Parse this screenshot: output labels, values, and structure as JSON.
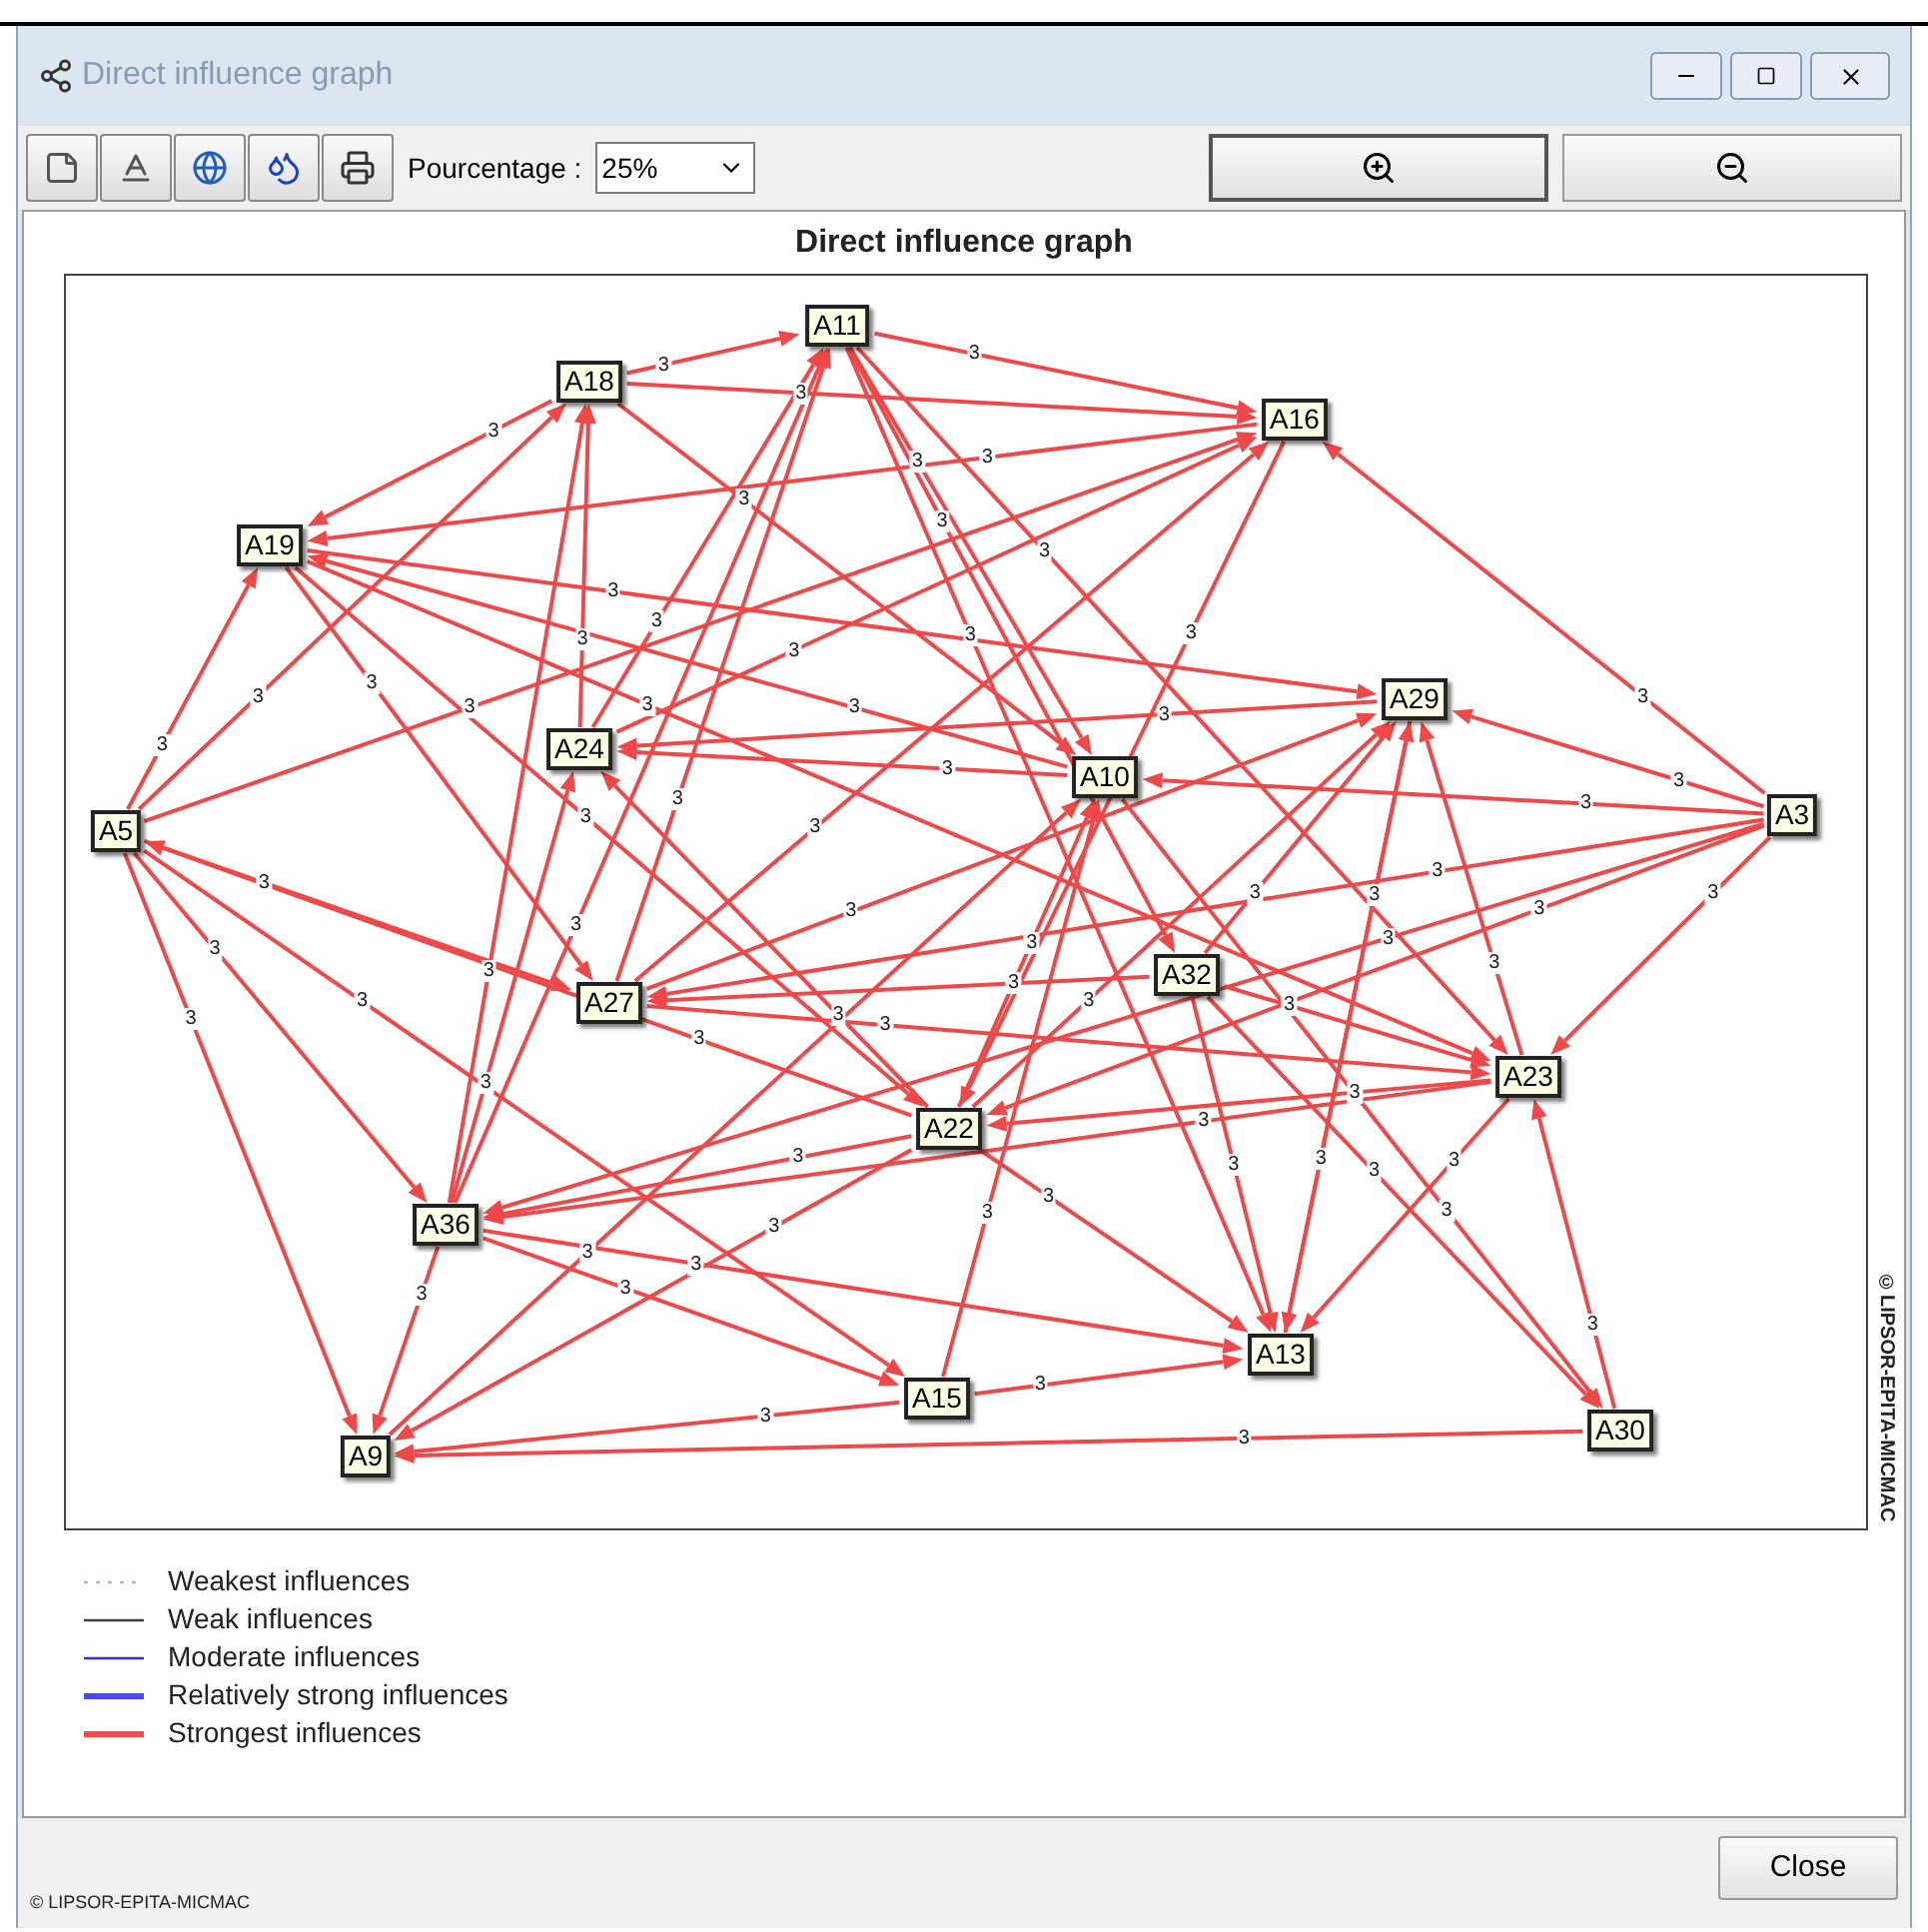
{
  "window": {
    "title": "Direct influence graph"
  },
  "toolbar": {
    "percent_label": "Pourcentage :",
    "percent_value": "25%"
  },
  "graph": {
    "title": "Direct influence graph",
    "nodes": [
      {
        "label": "A11"
      },
      {
        "label": "A18"
      },
      {
        "label": "A16"
      },
      {
        "label": "A19"
      },
      {
        "label": "A29"
      },
      {
        "label": "A24"
      },
      {
        "label": "A10"
      },
      {
        "label": "A5"
      },
      {
        "label": "A3"
      },
      {
        "label": "A32"
      },
      {
        "label": "A27"
      },
      {
        "label": "A23"
      },
      {
        "label": "A22"
      },
      {
        "label": "A36"
      },
      {
        "label": "A13"
      },
      {
        "label": "A15"
      },
      {
        "label": "A30"
      },
      {
        "label": "A9"
      }
    ],
    "edges": [
      {
        "label": "3"
      },
      {
        "label": "3"
      },
      {
        "label": "3"
      },
      {
        "label": "3"
      },
      {
        "label": "3"
      },
      {
        "label": "3"
      },
      {
        "label": "3"
      },
      {
        "label": "3"
      },
      {
        "label": "3"
      },
      {
        "label": "3"
      },
      {
        "label": "3"
      },
      {
        "label": "3"
      },
      {
        "label": "3"
      },
      {
        "label": "3"
      },
      {
        "label": "3"
      },
      {
        "label": "3"
      },
      {
        "label": "3"
      },
      {
        "label": "3"
      },
      {
        "label": "3"
      },
      {
        "label": "3"
      },
      {
        "label": "3"
      },
      {
        "label": "3"
      },
      {
        "label": "3"
      },
      {
        "label": "3"
      },
      {
        "label": "3"
      },
      {
        "label": "3"
      },
      {
        "label": "3"
      },
      {
        "label": "3"
      },
      {
        "label": "3"
      },
      {
        "label": "3"
      },
      {
        "label": "3"
      },
      {
        "label": "3"
      },
      {
        "label": "3"
      },
      {
        "label": "3"
      },
      {
        "label": "3"
      },
      {
        "label": "3"
      },
      {
        "label": "3"
      },
      {
        "label": "3"
      },
      {
        "label": "3"
      },
      {
        "label": "3"
      },
      {
        "label": "3"
      },
      {
        "label": "3"
      },
      {
        "label": "3"
      },
      {
        "label": "3"
      },
      {
        "label": "3"
      },
      {
        "label": "3"
      },
      {
        "label": "3"
      },
      {
        "label": "3"
      },
      {
        "label": "3"
      },
      {
        "label": "3"
      },
      {
        "label": "3"
      },
      {
        "label": "3"
      },
      {
        "label": "3"
      },
      {
        "label": "3"
      },
      {
        "label": "3"
      },
      {
        "label": "3"
      },
      {
        "label": "3"
      },
      {
        "label": "3"
      },
      {
        "label": "3"
      },
      {
        "label": "3"
      },
      {
        "label": "3"
      },
      {
        "label": "3"
      },
      {
        "label": "3"
      },
      {
        "label": "3"
      },
      {
        "label": "3"
      },
      {
        "label": "3"
      },
      {
        "label": "3"
      },
      {
        "label": "3"
      },
      {
        "label": "3"
      },
      {
        "label": "3"
      }
    ],
    "credit": "©LIPSOR-EPITA-MICMAC"
  },
  "legend": [
    {
      "label": "Weakest influences",
      "kind": "dotted",
      "color": "#b8b8b8"
    },
    {
      "label": "Weak influences",
      "kind": "thin",
      "color": "#404040"
    },
    {
      "label": "Moderate influences",
      "kind": "thin",
      "color": "#3030e0"
    },
    {
      "label": "Relatively strong influences",
      "kind": "thick",
      "color": "#4848ff"
    },
    {
      "label": "Strongest influences",
      "kind": "thick",
      "color": "#ff4848"
    }
  ],
  "buttons": {
    "close": "Close"
  },
  "footer": "© LIPSOR-EPITA-MICMAC"
}
